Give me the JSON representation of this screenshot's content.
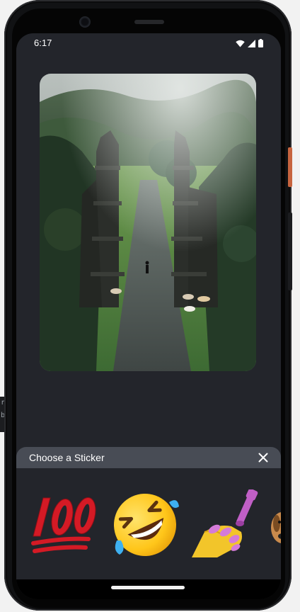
{
  "status_bar": {
    "time": "6:17",
    "icons": [
      "wifi-icon",
      "cell-signal-icon",
      "battery-icon"
    ]
  },
  "photo": {
    "subject": "temple-gate-photo"
  },
  "left_edge_text": [
    "r",
    "b"
  ],
  "sticker_panel": {
    "title": "Choose a Sticker",
    "close_icon": "close-icon",
    "stickers": [
      "💯",
      "🤣",
      "💅",
      "🐶"
    ]
  },
  "colors": {
    "screen_background": "#23252b",
    "panel_header": "#484c55",
    "text": "#ffffff",
    "power_button": "#c7643f"
  }
}
